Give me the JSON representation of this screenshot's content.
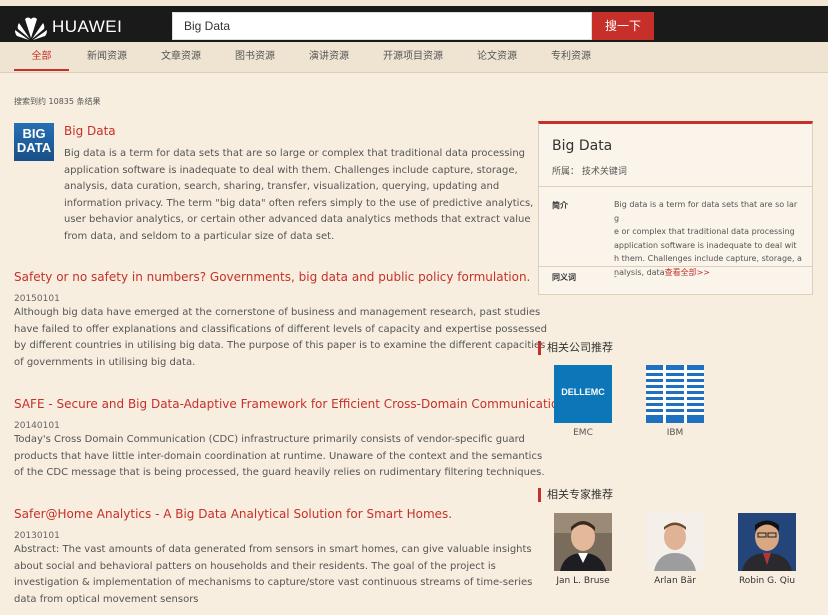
{
  "brand": {
    "name": "HUAWEI"
  },
  "search": {
    "query": "Big Data",
    "button": "搜一下"
  },
  "tabs": [
    "全部",
    "新闻资源",
    "文章资源",
    "图书资源",
    "演讲资源",
    "开源项目资源",
    "论文资源",
    "专利资源"
  ],
  "result_count": "搜索到约 10835 条结果",
  "featured": {
    "thumb_line1": "BIG",
    "thumb_line2": "DATA",
    "title": "Big Data",
    "lines": [
      "Big data is a term for data sets that are so large or complex that traditional data processing",
      "application software is inadequate to deal with them. Challenges include capture, storage,",
      "analysis, data curation, search, sharing, transfer, visualization, querying, updating and",
      "information privacy. The term \"big data\" often refers simply to the use of predictive analytics,",
      "user behavior analytics, or certain other advanced data analytics methods that extract value",
      "from data, and seldom to a particular size of data set."
    ]
  },
  "results": [
    {
      "title": "Safety or no safety in numbers? Governments, big data and public policy formulation.",
      "date": "20150101",
      "lines": [
        "Although big data have emerged at the cornerstone of business and management research, past studies",
        "have failed to offer explanations and classifications of different levels of capacity and expertise possessed",
        "by different countries in utilising big data. The purpose of this paper is to examine the different capacities",
        "of governments in utilising big data."
      ]
    },
    {
      "title": "SAFE - Secure and Big Data-Adaptive Framework for Efficient Cross-Domain Communication.",
      "date": "20140101",
      "lines": [
        "Today's Cross Domain Communication (CDC) infrastructure primarily consists of vendor-specific guard",
        "products that have little inter-domain coordination at runtime. Unaware of the context and the semantics",
        "of the CDC message that is being processed, the guard heavily relies on rudimentary filtering techniques."
      ]
    },
    {
      "title": "Safer@Home Analytics - A Big Data Analytical Solution for Smart Homes.",
      "date": "20130101",
      "lines": [
        "Abstract: The vast amounts of data generated from sensors in smart homes, can give valuable insights",
        "about social and behavioral patters on households and their residents. The goal of the project is",
        "investigation & implementation of mechanisms to capture/store vast continuous streams of time-series",
        "data from optical movement sensors"
      ]
    }
  ],
  "info_card": {
    "title": "Big Data",
    "attribute": "所属：  技术关键词",
    "intro_label": "简介",
    "intro_lines": [
      "Big data is a term for data sets that are so larg",
      "e or complex that traditional data processing",
      "application software is inadequate to deal wit",
      "h them. Challenges include capture, storage, a",
      "nalysis, data"
    ],
    "more_link": "查看全部>>",
    "synonym_label": "同义词",
    "synonym_value": "-"
  },
  "companies_section": {
    "heading": "相关公司推荐",
    "items": [
      {
        "name": "EMC",
        "logo_text": "DELLEMC"
      },
      {
        "name": "IBM",
        "logo_text": "IBM"
      }
    ]
  },
  "experts_section": {
    "heading": "相关专家推荐",
    "items": [
      {
        "name": "Jan L. Bruse"
      },
      {
        "name": "Arlan Bär"
      },
      {
        "name": "Robin G. Qiu"
      }
    ]
  },
  "colors": {
    "accent": "#c7302a",
    "background": "#f7eedf",
    "topbar": "#1a1a1a"
  }
}
